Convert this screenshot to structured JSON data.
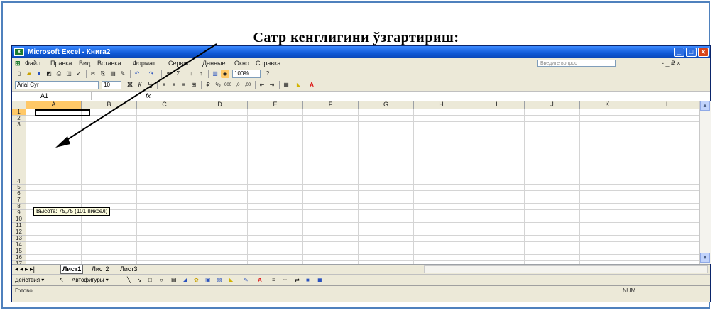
{
  "caption": "Сатр кенглигини ўзгартириш:",
  "window": {
    "title": "Microsoft Excel - Книга2",
    "app_icon": "excel-icon",
    "buttons": {
      "minimize": "_",
      "maximize": "□",
      "close": "✕"
    }
  },
  "menu": {
    "items": [
      "Файл",
      "Правка",
      "Вид",
      "Вставка",
      "Формат",
      "Сервис",
      "Данные",
      "Окно",
      "Справка"
    ],
    "ask_placeholder": "Введите вопрос",
    "right_controls": "- _ ₽ ×"
  },
  "toolbar": {
    "zoom": "100%",
    "font_name": "Arial Cyr",
    "font_size": "10"
  },
  "formula_bar": {
    "name_box": "A1",
    "fx": "fx"
  },
  "columns": [
    "A",
    "B",
    "C",
    "D",
    "E",
    "F",
    "G",
    "H",
    "I",
    "J",
    "K",
    "L"
  ],
  "rows": [
    "1",
    "2",
    "3",
    "4",
    "5",
    "6",
    "7",
    "8",
    "9",
    "10",
    "11",
    "12",
    "13",
    "14",
    "15",
    "16",
    "17"
  ],
  "tooltip": "Высота: 75,75 (101 пиксел)",
  "sheet_tabs": [
    "Лист1",
    "Лист2",
    "Лист3"
  ],
  "sheet_nav": "◂ ◂ ▸ ▸|",
  "draw_bar": {
    "actions": "Действия ▾",
    "autoshapes": "Автофигуры ▾"
  },
  "status": {
    "left": "Готово",
    "right": "NUM"
  },
  "colors": {
    "frame_border": "#4f81bd",
    "titlebar": "#0f58d6",
    "selected_header": "#ffc867",
    "tooltip_bg": "#ffffe1"
  }
}
